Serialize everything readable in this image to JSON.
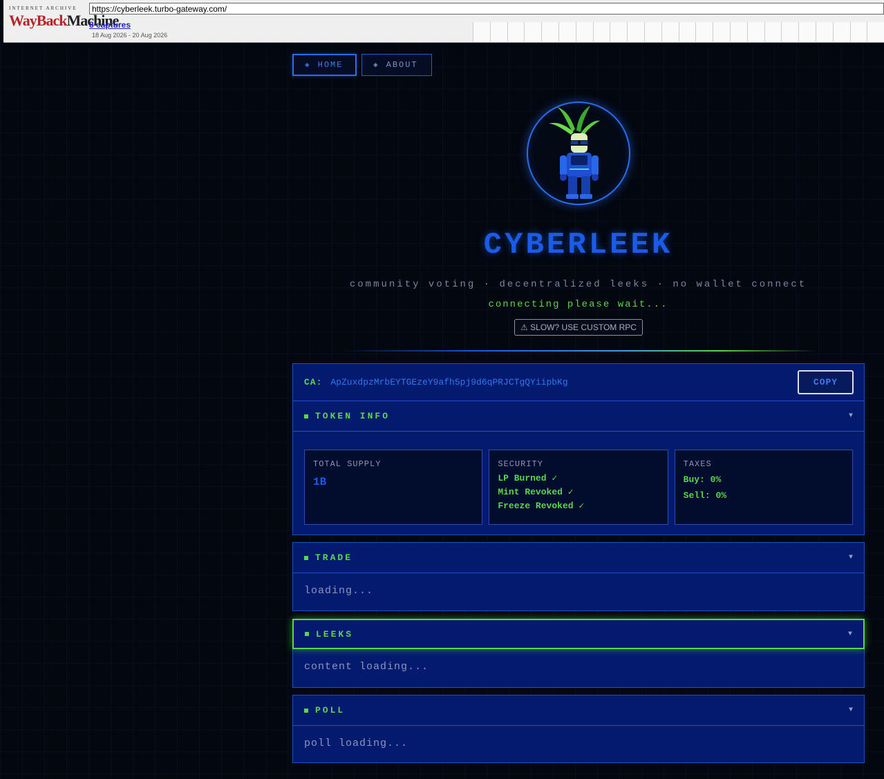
{
  "wayback": {
    "logo_top": "INTERNET ARCHIVE",
    "logo_w1": "WayBack",
    "logo_w2": "Machine",
    "url": "https://cyberleek.turbo-gateway.com/",
    "captures": "8 captures",
    "dates": "18 Aug 2026 - 20 Aug 2026"
  },
  "nav": {
    "home": "HOME",
    "about": "ABOUT",
    "gem": "◈"
  },
  "hero": {
    "title": "CYBERLEEK",
    "tagline": "community voting · decentralized leeks · no wallet connect",
    "status": "connecting please wait...",
    "rpc_button": "⚠ SLOW? USE CUSTOM RPC"
  },
  "contract": {
    "label": "CA:",
    "address": "ApZuxdpzMrbEYTGEzeY9afh5pj9d6qPRJCTgQYiipbKg",
    "copy_label": "COPY"
  },
  "token_info": {
    "header": "TOKEN INFO",
    "supply_label": "TOTAL SUPPLY",
    "supply_value": "1B",
    "security_label": "SECURITY",
    "security_items": [
      "LP Burned ✓",
      "Mint Revoked ✓",
      "Freeze Revoked ✓"
    ],
    "taxes_label": "TAXES",
    "buy": "Buy: 0%",
    "sell": "Sell: 0%"
  },
  "trade": {
    "header": "TRADE",
    "body": "loading..."
  },
  "leeks": {
    "header": "LEEKS",
    "body": "content loading..."
  },
  "poll": {
    "header": "POLL",
    "body": "poll loading..."
  },
  "chevron": "▼",
  "colors": {
    "accent_blue": "#1a5ce8",
    "accent_green": "#5cd64a",
    "panel_bg": "#041a6e"
  }
}
